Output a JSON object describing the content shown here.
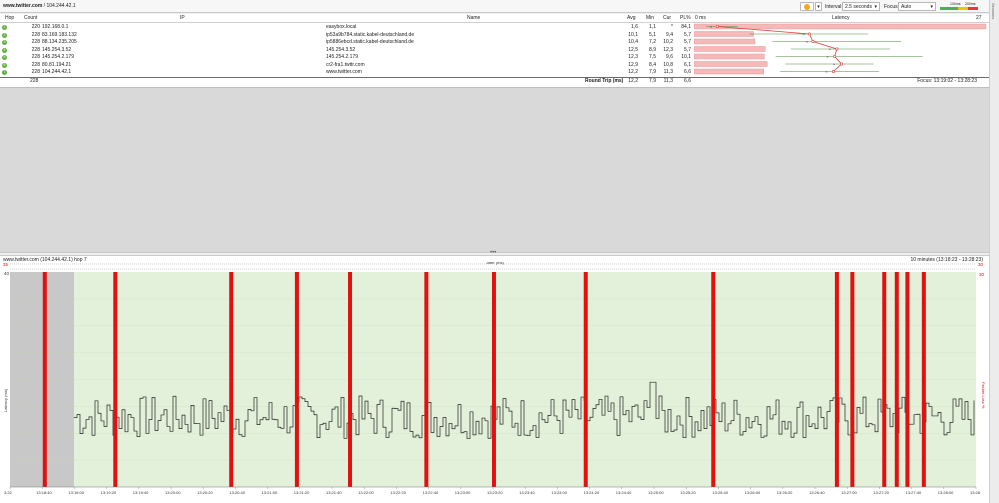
{
  "window": {
    "host": "www.twitter.com",
    "separator": " / ",
    "ip": "104.244.42.1"
  },
  "toolbar": {
    "pause_icon": "circle-icon",
    "interval_label": "Interval:",
    "interval_value": "2.5 seconds",
    "focus_label": "Focus:",
    "focus_value": "Auto",
    "legend_100": "100ms",
    "legend_200": "200ms",
    "colors": {
      "ok": "#4caf50",
      "warn": "#f2c200",
      "bad": "#e53935"
    }
  },
  "side_rail": {
    "label": "Sessions"
  },
  "table": {
    "headers": {
      "hop": "Hop",
      "count": "Count",
      "ip": "IP",
      "name": "Name",
      "avg": "Avg",
      "min": "Min",
      "cur": "Cur",
      "pl": "PL%",
      "latency": "Latency",
      "lat_left": "0 ms",
      "lat_right": "27 ms"
    },
    "rows": [
      {
        "hop": "1",
        "count": "220",
        "ip": "192.168.0.1",
        "name": "easybox.local",
        "avg": "1,6",
        "min": "1,1",
        "cur": "*",
        "pl": "84,1",
        "avg_ms": 1.6,
        "min_ms": 1.1,
        "max_ms": 4.0,
        "pl_pct": 84.1
      },
      {
        "hop": "2",
        "count": "228",
        "ip": "83.169.183.132",
        "name": "ip53a9b784.static.kabel-deutschland.de",
        "avg": "10,1",
        "min": "5,1",
        "cur": "9,4",
        "pl": "5,7",
        "avg_ms": 10.1,
        "min_ms": 5.1,
        "max_ms": 16.0,
        "pl_pct": 5.7
      },
      {
        "hop": "3",
        "count": "228",
        "ip": "88.134.235.205",
        "name": "ip5886ebcd.static.kabel-deutschland.de",
        "avg": "10,4",
        "min": "7,2",
        "cur": "10,2",
        "pl": "5,7",
        "avg_ms": 10.4,
        "min_ms": 7.2,
        "max_ms": 19.0,
        "pl_pct": 5.7
      },
      {
        "hop": "4",
        "count": "228",
        "ip": "145.254.3.52",
        "name": "145.254.3.52",
        "avg": "12,5",
        "min": "8,9",
        "cur": "12,3",
        "pl": "5,7",
        "avg_ms": 12.5,
        "min_ms": 8.9,
        "max_ms": 18.0,
        "pl_pct": 5.7
      },
      {
        "hop": "5",
        "count": "228",
        "ip": "145.254.2.179",
        "name": "145.254.2.179",
        "avg": "12,3",
        "min": "7,5",
        "cur": "9,6",
        "pl": "10,1",
        "avg_ms": 12.3,
        "min_ms": 7.5,
        "max_ms": 21.0,
        "pl_pct": 10.1
      },
      {
        "hop": "6",
        "count": "228",
        "ip": "80.81.194.21",
        "name": "cr2-fra1.twttr.com",
        "avg": "12,9",
        "min": "8,4",
        "cur": "10,8",
        "pl": "6,1",
        "avg_ms": 12.9,
        "min_ms": 8.4,
        "max_ms": 16.5,
        "pl_pct": 6.1
      },
      {
        "hop": "7",
        "count": "228",
        "ip": "104.244.42.1",
        "name": "www.twitter.com",
        "avg": "12,2",
        "min": "7,9",
        "cur": "11,3",
        "pl": "6,6",
        "avg_ms": 12.2,
        "min_ms": 7.9,
        "max_ms": 17.0,
        "pl_pct": 6.6
      }
    ],
    "summary": {
      "count": "228",
      "label": "Round Trip (ms)",
      "avg": "12,2",
      "min": "7,9",
      "cur": "11,3",
      "pl": "6,6"
    },
    "focus_text": "Focus: 13:19:02 - 13:28:23"
  },
  "graph": {
    "title": "www.twitter.com (104.244.42.1) hop 7",
    "range_text": "10 minutes (13:18:23 - 13:28:23)",
    "jitter_label": "Jitter (ms)",
    "y_left_label": "Latency (ms)",
    "y_right_label": "Packet Loss %",
    "y_max_left": "40",
    "y_max_right": "30",
    "top_left_value": "35",
    "top_right_value": "30",
    "x_ticks": [
      "3:22",
      "13:18:40",
      "13:19:00",
      "13:19:20",
      "13:19:40",
      "13:20:00",
      "13:20:20",
      "13:20:40",
      "13:21:00",
      "13:21:20",
      "13:21:40",
      "13:22:00",
      "13:22:20",
      "13:22:40",
      "13:23:00",
      "13:23:20",
      "13:23:40",
      "13:24:00",
      "13:24:20",
      "13:24:40",
      "13:25:00",
      "13:25:20",
      "13:25:40",
      "13:26:00",
      "13:26:20",
      "13:26:40",
      "13:27:00",
      "13:27:20",
      "13:27:40",
      "13:28:00",
      "13:28"
    ],
    "loss_times_pct": [
      0.036,
      0.109,
      0.229,
      0.297,
      0.352,
      0.431,
      0.501,
      0.596,
      0.728,
      0.856,
      0.872,
      0.905,
      0.918,
      0.929,
      0.946
    ],
    "spike_pct": 0.665,
    "spike_ms": 19.5,
    "no_data_end_pct": 0.0,
    "colors": {
      "plot_bg": "#e4f1da",
      "nodata_bg": "#c8c8c8",
      "loss": "#e4100f",
      "line": "#222222",
      "grid": "#c6d6bb"
    }
  }
}
